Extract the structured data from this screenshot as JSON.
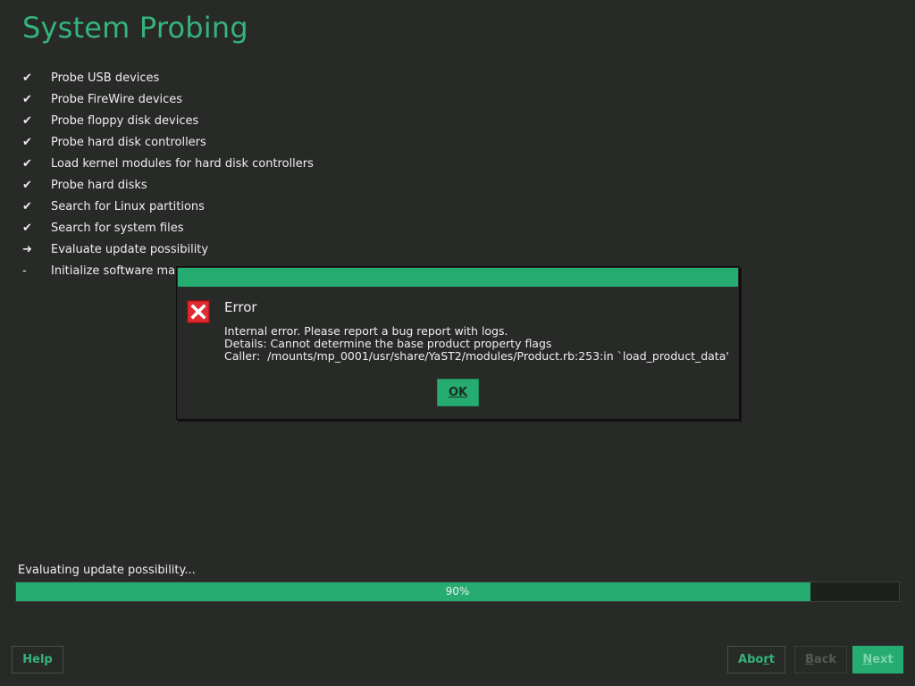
{
  "header": {
    "title": "System Probing"
  },
  "steps": [
    {
      "marker": "✔",
      "label": "Probe USB devices"
    },
    {
      "marker": "✔",
      "label": "Probe FireWire devices"
    },
    {
      "marker": "✔",
      "label": "Probe floppy disk devices"
    },
    {
      "marker": "✔",
      "label": "Probe hard disk controllers"
    },
    {
      "marker": "✔",
      "label": "Load kernel modules for hard disk controllers"
    },
    {
      "marker": "✔",
      "label": "Probe hard disks"
    },
    {
      "marker": "✔",
      "label": "Search for Linux partitions"
    },
    {
      "marker": "✔",
      "label": "Search for system files"
    },
    {
      "marker": "➜",
      "label": "Evaluate update possibility"
    },
    {
      "marker": "-",
      "label": "Initialize software mana"
    }
  ],
  "dialog": {
    "heading": "Error",
    "icon": "error-x-icon",
    "message_lines": [
      "Internal error. Please report a bug report with logs.",
      "Details: Cannot determine the base product property flags",
      "Caller:  /mounts/mp_0001/usr/share/YaST2/modules/Product.rb:253:in `load_product_data'"
    ],
    "ok_label": "OK"
  },
  "progress": {
    "label": "Evaluating update possibility...",
    "value": 90,
    "text": "90%"
  },
  "buttons": {
    "help": "Help",
    "abort_pre": "Abo",
    "abort_mn": "r",
    "abort_post": "t",
    "back_mn": "B",
    "back_post": "ack",
    "next_mn": "N",
    "next_post": "ext"
  },
  "colors": {
    "accent": "#26ab71",
    "title": "#35b37b",
    "background": "#282a28",
    "error_icon": "#d0202a"
  }
}
